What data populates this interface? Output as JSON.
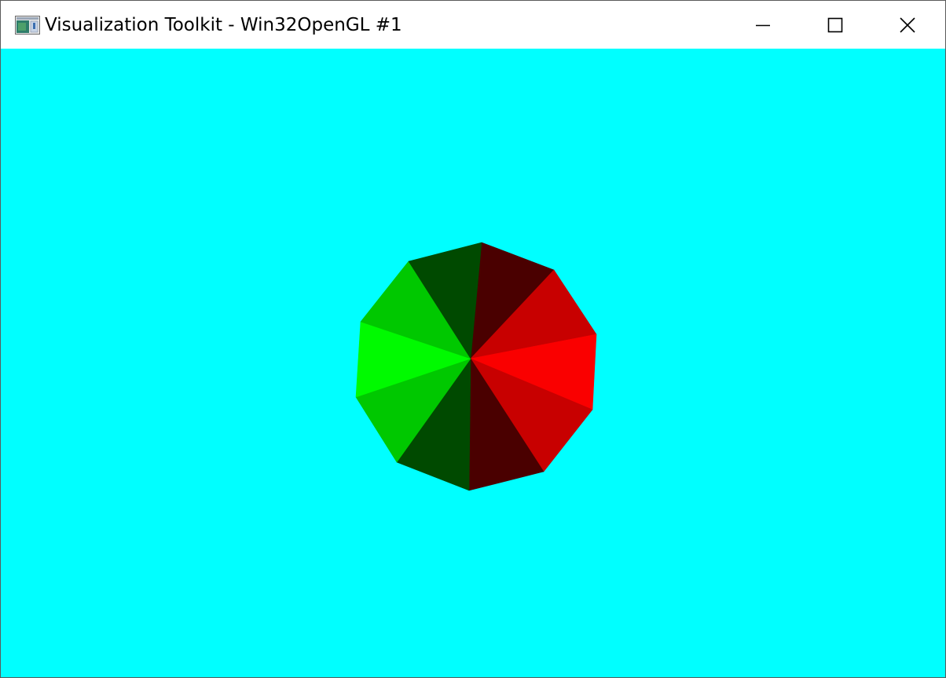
{
  "window": {
    "title": "Visualization Toolkit - Win32OpenGL #1",
    "icon": "vtk-app-icon",
    "controls": {
      "minimize": "minimize-icon",
      "maximize": "maximize-icon",
      "close": "close-icon"
    }
  },
  "render": {
    "background_color": "#00ffff",
    "shape": "cone-tip-decagon",
    "face_colors": [
      "#4a0000",
      "#c80000",
      "#fa0000",
      "#c80000",
      "#4a0000",
      "#004a00",
      "#00c800",
      "#00fa00",
      "#00c800",
      "#004a00"
    ]
  }
}
